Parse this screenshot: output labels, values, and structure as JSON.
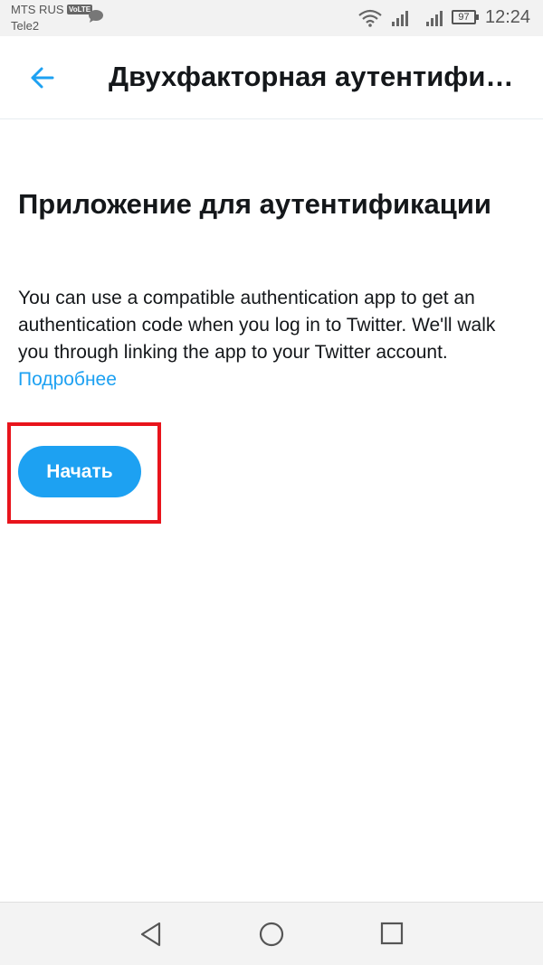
{
  "status_bar": {
    "carrier_primary": "MTS RUS",
    "volte_badge": "VoLTE",
    "carrier_secondary": "Tele2",
    "battery_level": "97",
    "time": "12:24"
  },
  "app_bar": {
    "title": "Двухфакторная аутентифик…"
  },
  "content": {
    "heading": "Приложение для аутентификации",
    "description": "You can use a compatible authentication app to get an authentication code when you log in to Twitter. We'll walk you through linking the app to your Twitter account.",
    "learn_more": "Подробнее",
    "start_button": "Начать"
  },
  "colors": {
    "accent": "#1da1f2",
    "highlight": "#e8141c",
    "text": "#14171a"
  }
}
